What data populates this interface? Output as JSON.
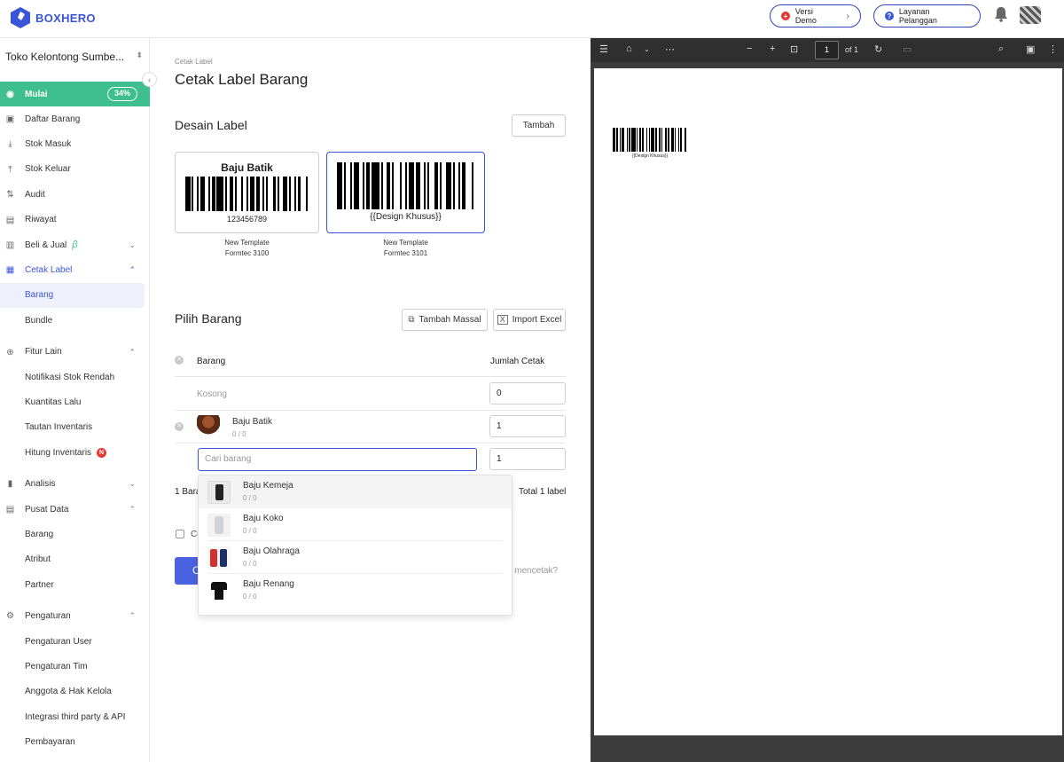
{
  "header": {
    "logo_text": "BOXHERO",
    "demo_button": "Versi Demo",
    "support_button": "Layanan Pelanggan"
  },
  "sidebar": {
    "store_name": "Toko Kelontong Sumbe...",
    "progress": "34%",
    "items": [
      {
        "label": "Mulai"
      },
      {
        "label": "Daftar Barang"
      },
      {
        "label": "Stok Masuk"
      },
      {
        "label": "Stok Keluar"
      },
      {
        "label": "Audit"
      },
      {
        "label": "Riwayat"
      },
      {
        "label": "Beli & Jual",
        "beta": "β"
      },
      {
        "label": "Cetak Label"
      },
      {
        "label": "Barang"
      },
      {
        "label": "Bundle"
      },
      {
        "label": "Fitur Lain"
      },
      {
        "label": "Notifikasi Stok Rendah"
      },
      {
        "label": "Kuantitas Lalu"
      },
      {
        "label": "Tautan Inventaris"
      },
      {
        "label": "Hitung Inventaris",
        "badge": "N"
      },
      {
        "label": "Analisis"
      },
      {
        "label": "Pusat Data"
      },
      {
        "label": "Barang"
      },
      {
        "label": "Atribut"
      },
      {
        "label": "Partner"
      },
      {
        "label": "Pengaturan"
      },
      {
        "label": "Pengaturan User"
      },
      {
        "label": "Pengaturan Tim"
      },
      {
        "label": "Anggota & Hak Kelola"
      },
      {
        "label": "Integrasi third party & API"
      },
      {
        "label": "Pembayaran"
      }
    ]
  },
  "main": {
    "breadcrumb": "Cetak Label",
    "title": "Cetak Label Barang",
    "design_section": "Desain Label",
    "add_button": "Tambah",
    "templates": [
      {
        "title": "Baju Batik",
        "code": "123456789",
        "caption1": "New Template",
        "caption2": "Formtec 3100"
      },
      {
        "title": "",
        "code": "{{Design Khusus}}",
        "caption1": "New Template",
        "caption2": "Formtec 3101"
      }
    ],
    "select_section": "Pilih Barang",
    "bulk_add_button": "Tambah Massal",
    "import_button": "Import Excel",
    "col_item": "Barang",
    "col_qty": "Jumlah Cetak",
    "empty_row": {
      "label": "Kosong",
      "qty": "0"
    },
    "item_row": {
      "name": "Baju Batik",
      "stock": "0 / 0",
      "qty": "1"
    },
    "search_row": {
      "placeholder": "Cari barang",
      "qty": "1"
    },
    "summary_left": "1 Bara",
    "summary_right": "Total 1 label",
    "checkbox_label": "Ce",
    "print_button": "C",
    "help_text": "at mencetak?",
    "dropdown": [
      {
        "name": "Baju Kemeja",
        "stock": "0 / 0"
      },
      {
        "name": "Baju Koko",
        "stock": "0 / 0"
      },
      {
        "name": "Baju Olahraga",
        "stock": "0 / 0"
      },
      {
        "name": "Baju Renang",
        "stock": "0 / 0"
      }
    ]
  },
  "viewer": {
    "page_number": "1",
    "page_total": "of 1",
    "label_text": "{{Design Khusus}}"
  },
  "colors": {
    "accent": "#3b55d9",
    "green": "#3fbf8f",
    "primary_button": "#4a63e0",
    "viewer_bg": "#3c3c3c"
  }
}
